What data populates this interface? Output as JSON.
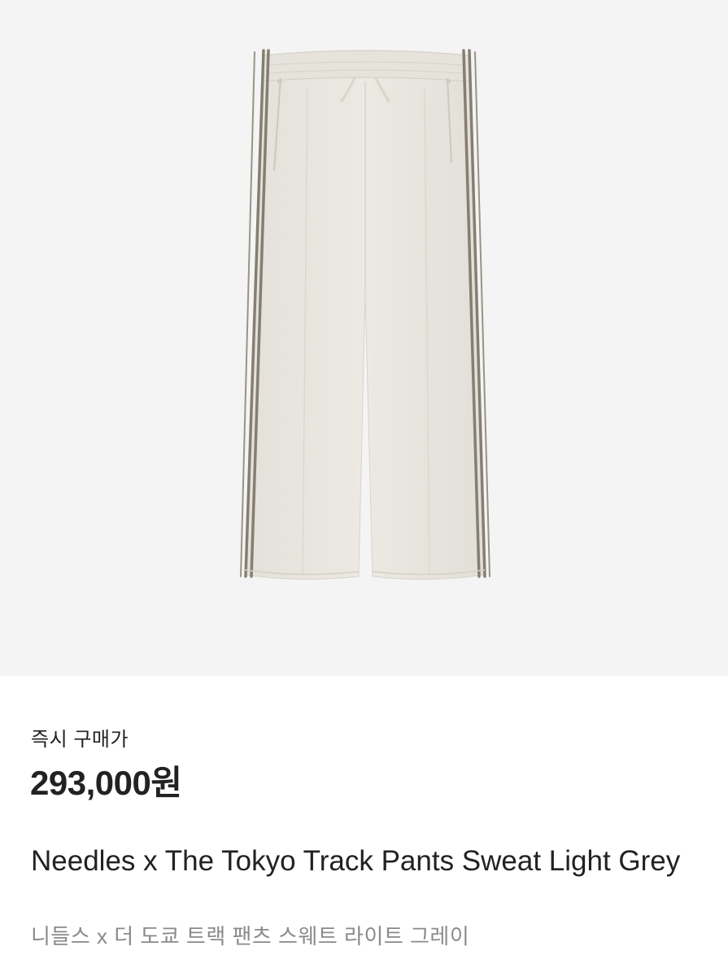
{
  "product": {
    "image_subject": "light grey track pants with dark side stripes",
    "price_label": "즉시 구매가",
    "price": "293,000원",
    "title": "Needles x The Tokyo Track Pants Sweat Light Grey",
    "subtitle": "니들스 x 더 도쿄 트랙 팬츠 스웨트 라이트 그레이"
  },
  "colors": {
    "image_background": "#f4f4f4",
    "pants_fabric": "#e9e6e0",
    "stripe": "#857e72",
    "text_primary": "#222222",
    "text_secondary": "#8a8a8a"
  }
}
